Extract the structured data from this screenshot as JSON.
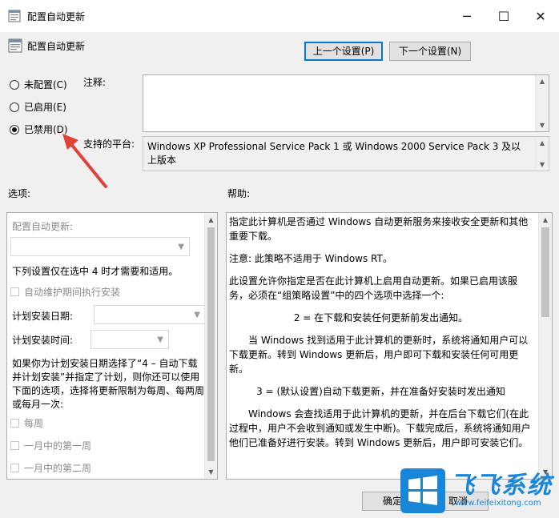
{
  "window": {
    "title": "配置自动更新",
    "controls": {
      "minimize": "─",
      "maximize": "☐",
      "close": "✕"
    }
  },
  "header": {
    "policy_name": "配置自动更新",
    "prev_button": "上一个设置(P)",
    "next_button": "下一个设置(N)"
  },
  "state": {
    "options": [
      {
        "label": "未配置(C)",
        "selected": false
      },
      {
        "label": "已启用(E)",
        "selected": false
      },
      {
        "label": "已禁用(D)",
        "selected": true
      }
    ]
  },
  "comment": {
    "label": "注释:",
    "value": ""
  },
  "platform": {
    "label": "支持的平台:",
    "value": "Windows XP Professional Service Pack 1 或 Windows 2000 Service Pack 3 及以上版本"
  },
  "options_panel": {
    "label": "选项:",
    "auto_update_label": "配置自动更新:",
    "note": "下列设置仅在选中 4 时才需要和适用。",
    "maintenance_checkbox": "自动维护期间执行安装",
    "schedule_day_label": "计划安装日期:",
    "schedule_time_label": "计划安装时间:",
    "paragraph": "如果你为计划安装日期选择了“4 – 自动下载并计划安装”并指定了计划，则你还可以使用下面的选项，选择将更新限制为每周、每两周或每月一次:",
    "weekly_checkbox": "每周",
    "first_week_checkbox": "一月中的第一周",
    "second_week_checkbox": "一月中的第二周"
  },
  "help_panel": {
    "label": "帮助:",
    "paragraphs": [
      "指定此计算机是否通过 Windows 自动更新服务来接收安全更新和其他重要下载。",
      "注意: 此策略不适用于 Windows RT。",
      "此设置允许你指定是否在此计算机上启用自动更新。如果已启用该服务，必须在“组策略设置”中的四个选项中选择一个:",
      "2 = 在下载和安装任何更新前发出通知。",
      "当 Windows 找到适用于此计算机的更新时，系统将通知用户可以下载更新。转到 Windows 更新后，用户即可下载和安装任何可用更新。",
      "3 = (默认设置)自动下载更新，并在准备好安装时发出通知",
      "Windows 会查找适用于此计算机的更新，并在后台下载它们(在此过程中，用户不会收到通知或发生中断)。下载完成后，系统将通知用户他们已准备好进行安装。转到 Windows 更新后，用户即可安装它们。"
    ]
  },
  "footer": {
    "ok_button": "确定",
    "cancel_button": "取消"
  },
  "watermark": {
    "brand": "飞飞系统",
    "url": "www.feifeixitong.com"
  },
  "colors": {
    "accent": "#0078d7",
    "arrow": "#e0413a",
    "watermark": "#1a86d8"
  }
}
